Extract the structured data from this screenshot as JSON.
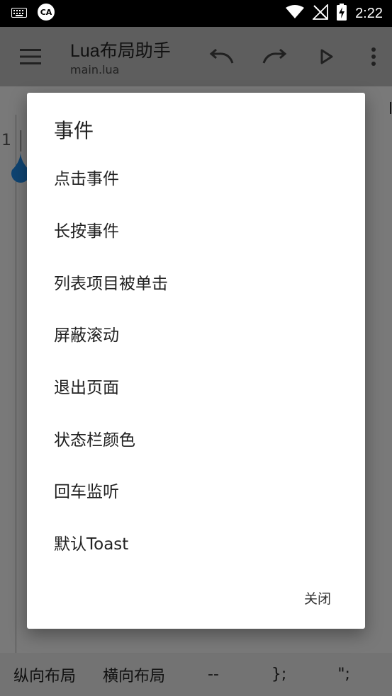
{
  "status_bar": {
    "time": "2:22",
    "icons": [
      "keyboard-icon",
      "app-notification-icon",
      "wifi-icon",
      "no-signal-icon",
      "battery-charging-icon"
    ]
  },
  "toolbar": {
    "title": "Lua布局助手",
    "subtitle": "main.lua",
    "icons": [
      "menu-icon",
      "undo-icon",
      "redo-icon",
      "play-icon",
      "more-vert-icon"
    ]
  },
  "editor": {
    "line_number": "1",
    "edge_char": "l"
  },
  "bottom_bar": {
    "items": [
      "纵向布局",
      "横向布局",
      "--",
      "};",
      "\";"
    ]
  },
  "dialog": {
    "title": "事件",
    "items": [
      "点击事件",
      "长按事件",
      "列表项目被单击",
      "屏蔽滚动",
      "退出页面",
      "状态栏颜色",
      "回车监听",
      "默认Toast"
    ],
    "close_label": "关闭"
  },
  "colors": {
    "status_bar": "#000000",
    "toolbar": "#bdbdbd",
    "dialog_bg": "#ffffff",
    "accent_drop": "#1e88e5"
  }
}
